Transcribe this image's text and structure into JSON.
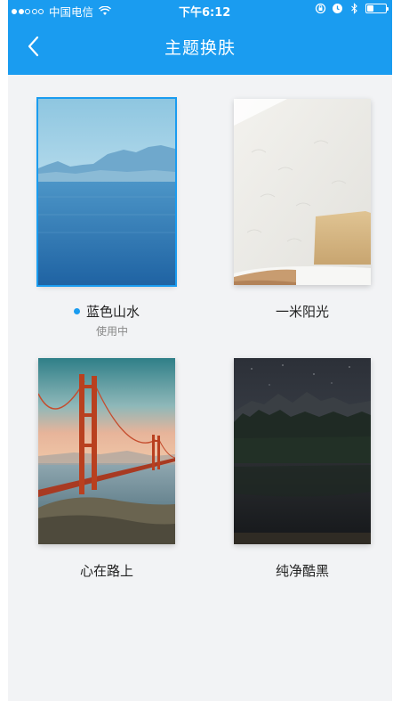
{
  "status_bar": {
    "carrier": "中国电信",
    "time": "下午6:12",
    "battery_level": 0.35
  },
  "nav": {
    "title": "主题换肤"
  },
  "themes": [
    {
      "name": "蓝色山水",
      "status": "使用中",
      "selected": true
    },
    {
      "name": "一米阳光",
      "status": "",
      "selected": false
    },
    {
      "name": "心在路上",
      "status": "",
      "selected": false
    },
    {
      "name": "纯净酷黑",
      "status": "",
      "selected": false
    }
  ],
  "colors": {
    "accent": "#1a9cf0",
    "background": "#f2f3f5"
  }
}
